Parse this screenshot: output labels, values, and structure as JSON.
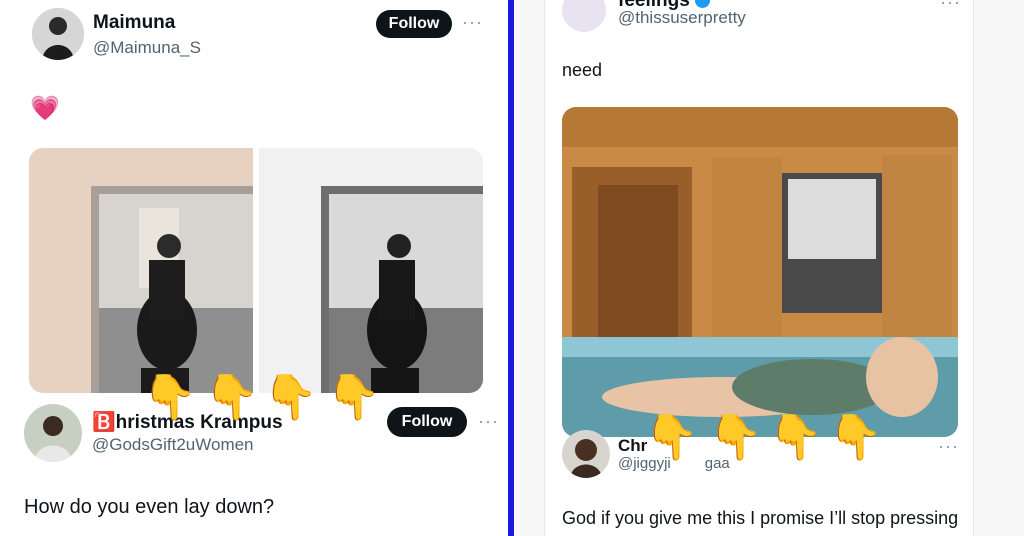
{
  "left": {
    "tweet1": {
      "author_name": "Maimuna",
      "author_handle": "@Maimuna_S",
      "follow_label": "Follow",
      "more_label": "···",
      "text": "💗"
    },
    "reply": {
      "author_badge": "🅱️",
      "author_name": "hristmas Krampus",
      "author_handle": "@GodsGift2uWomen",
      "follow_label": "Follow",
      "more_label": "···",
      "text": "How do you even lay down?"
    },
    "pointers": [
      "👇",
      "👇",
      "👇",
      "👇"
    ]
  },
  "right": {
    "tweet1": {
      "author_name": "feelings",
      "author_handle": "@thissuserpretty",
      "more_label": "···",
      "text": "need"
    },
    "reply": {
      "author_name": "Chr",
      "author_handle": "@jiggyji",
      "author_handle_tail": "gaa",
      "more_label": "···",
      "text": "God if you give me this I promise I’ll stop pressing"
    },
    "pointers": [
      "👇",
      "👇",
      "👇",
      "👇"
    ]
  },
  "colors": {
    "divider": "#1a1adf",
    "follow_bg": "#0f1419",
    "verified": "#1d9bf0"
  }
}
